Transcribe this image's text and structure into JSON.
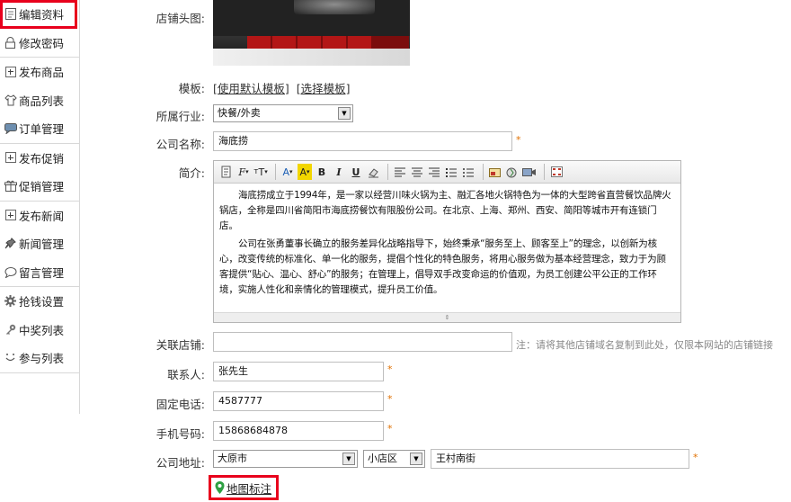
{
  "sidebar": {
    "groups": [
      [
        {
          "label": "编辑资料",
          "icon": "profile-icon",
          "active": true
        },
        {
          "label": "修改密码",
          "icon": "lock-icon"
        }
      ],
      [
        {
          "label": "发布商品",
          "icon": "plus-box-icon"
        },
        {
          "label": "商品列表",
          "icon": "shirt-icon"
        },
        {
          "label": "订单管理",
          "icon": "chat-icon"
        }
      ],
      [
        {
          "label": "发布促销",
          "icon": "plus-box-icon"
        },
        {
          "label": "促销管理",
          "icon": "gift-icon"
        }
      ],
      [
        {
          "label": "发布新闻",
          "icon": "plus-box-icon"
        },
        {
          "label": "新闻管理",
          "icon": "pin-icon"
        },
        {
          "label": "留言管理",
          "icon": "speech-bubble-icon"
        }
      ],
      [
        {
          "label": "抢钱设置",
          "icon": "gear-icon"
        },
        {
          "label": "中奖列表",
          "icon": "key-icon"
        },
        {
          "label": "参与列表",
          "icon": "smile-icon"
        }
      ]
    ]
  },
  "form": {
    "shop_image_label": "店铺头图:",
    "template_label": "模板:",
    "template_default": "[使用默认模板]",
    "template_select": "[选择模板]",
    "industry_label": "所属行业:",
    "industry_value": "快餐/外卖",
    "company_name_label": "公司名称:",
    "company_name_value": "海底捞",
    "intro_label": "简介:",
    "intro_paragraphs": [
      "海底捞成立于1994年，是一家以经营川味火锅为主、融汇各地火锅特色为一体的大型跨省直营餐饮品牌火锅店，全称是四川省简阳市海底捞餐饮有限股份公司。在北京、上海、郑州、西安、简阳等城市开有连锁门店。",
      "公司在张勇董事长确立的服务差异化战略指导下，始终秉承“服务至上、顾客至上”的理念，以创新为核心，改变传统的标准化、单一化的服务，提倡个性化的特色服务，将用心服务做为基本经营理念，致力于为顾客提供“贴心、温心、舒心”的服务；在管理上，倡导双手改变命运的价值观，为员工创建公平公正的工作环境，实施人性化和亲情化的管理模式，提升员工价值。"
    ],
    "linked_shop_label": "关联店铺:",
    "linked_shop_value": "",
    "linked_shop_note": "注：请将其他店铺域名复制到此处，仅限本网站的店铺链接",
    "contact_label": "联系人:",
    "contact_value": "张先生",
    "phone_label": "固定电话:",
    "phone_value": "4587777",
    "mobile_label": "手机号码:",
    "mobile_value": "15868684878",
    "address_label": "公司地址:",
    "address_city": "大原市",
    "address_district": "小店区",
    "address_street": "王村南街",
    "required_mark": "*",
    "map_link": "地图标注"
  },
  "colors": {
    "highlight_border": "#e8001c",
    "required": "#e07000",
    "map_pin": "#2ea043"
  }
}
